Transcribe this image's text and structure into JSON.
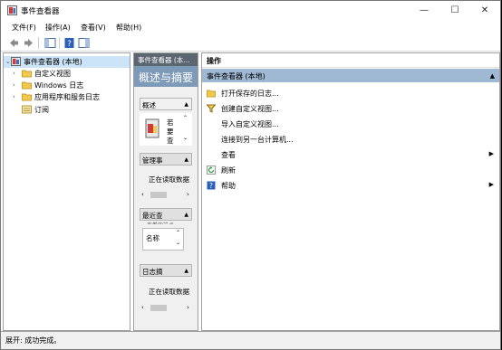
{
  "window": {
    "title": "事件查看器",
    "minimize": "—",
    "maximize": "☐",
    "close": "✕"
  },
  "menu": [
    "文件(F)",
    "操作(A)",
    "查看(V)",
    "帮助(H)"
  ],
  "tree": {
    "root": "事件查看器 (本地)",
    "items": [
      "自定义视图",
      "Windows 日志",
      "应用程序和服务日志",
      "订阅"
    ]
  },
  "middle": {
    "header": "事件查看器 (本...",
    "banner": "概述与摘要",
    "overview_label": "概述",
    "overview_text": [
      "若",
      "要",
      "查"
    ],
    "admin_label": "管理事",
    "admin_status": "正在读取数据",
    "recent_label": "最近查",
    "recent_sub": "查看的节点",
    "name_label": "名称",
    "summary_label": "日志摘",
    "summary_status": "正在读取数据"
  },
  "actions": {
    "header": "操作",
    "section": "事件查看器 (本地)",
    "items": [
      {
        "label": "打开保存的日志...",
        "icon": "folder-icon",
        "sub": ""
      },
      {
        "label": "创建自定义视图...",
        "icon": "filter-icon",
        "sub": ""
      },
      {
        "label": "导入自定义视图...",
        "icon": "",
        "sub": ""
      },
      {
        "label": "连接到另一台计算机...",
        "icon": "",
        "sub": ""
      },
      {
        "label": "查看",
        "icon": "",
        "sub": "▶"
      },
      {
        "label": "刷新",
        "icon": "refresh-icon",
        "sub": ""
      },
      {
        "label": "帮助",
        "icon": "help-icon",
        "sub": "▶"
      }
    ]
  },
  "status": "展开: 成功完成。"
}
